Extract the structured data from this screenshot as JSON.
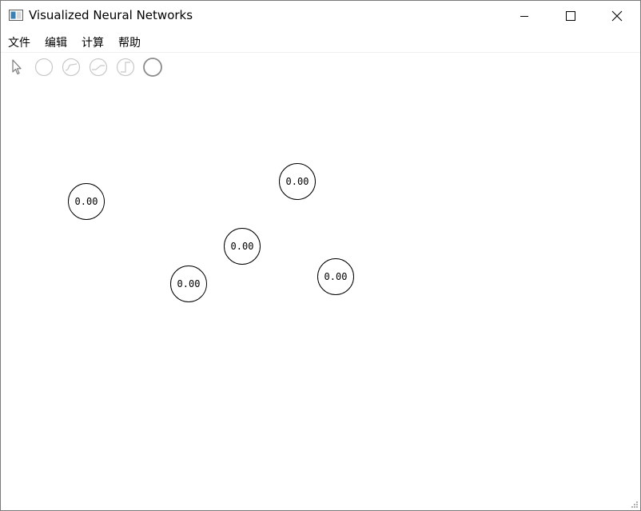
{
  "window": {
    "title": "Visualized Neural Networks",
    "controls": [
      "minimize",
      "maximize",
      "close"
    ]
  },
  "menubar": {
    "items": [
      "文件",
      "编辑",
      "计算",
      "帮助"
    ]
  },
  "toolbar": {
    "tools": [
      {
        "icon": "pointer-icon",
        "state": "active"
      },
      {
        "icon": "neuron-blank-icon",
        "state": "disabled"
      },
      {
        "icon": "neuron-sigmoid-icon",
        "state": "disabled"
      },
      {
        "icon": "neuron-linear-icon",
        "state": "disabled"
      },
      {
        "icon": "neuron-step-icon",
        "state": "disabled"
      },
      {
        "icon": "neuron-circle-icon",
        "state": "enabled"
      }
    ]
  },
  "canvas": {
    "neurons": [
      {
        "value": "0.00"
      },
      {
        "value": "0.00"
      },
      {
        "value": "0.00"
      },
      {
        "value": "0.00"
      },
      {
        "value": "0.00"
      }
    ]
  }
}
